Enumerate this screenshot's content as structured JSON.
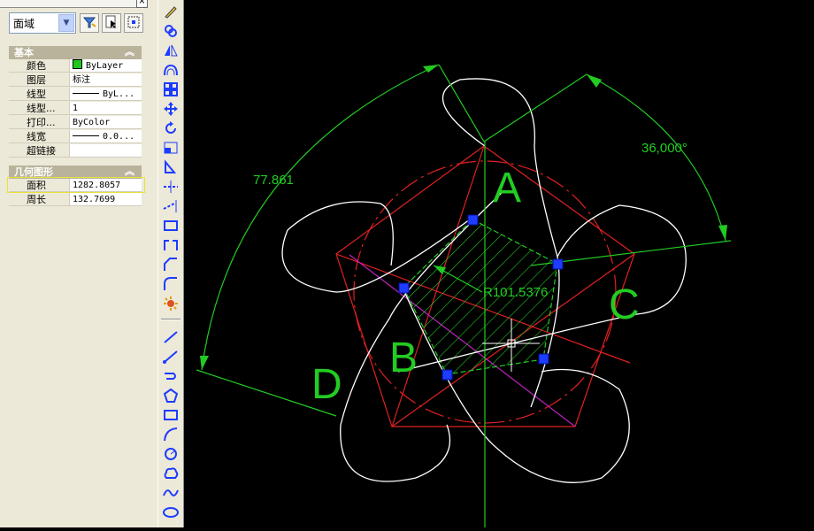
{
  "properties_palette": {
    "object_type": "面域",
    "sections": {
      "basic": {
        "title": "基本",
        "rows": [
          {
            "key": "颜色",
            "value": "ByLayer"
          },
          {
            "key": "图层",
            "value": "标注"
          },
          {
            "key": "线型",
            "value": "ByL..."
          },
          {
            "key": "线型...",
            "value": "1"
          },
          {
            "key": "打印...",
            "value": "ByColor"
          },
          {
            "key": "线宽",
            "value": "0.0..."
          },
          {
            "key": "超链接",
            "value": ""
          }
        ]
      },
      "geometry": {
        "title": "几何图形",
        "rows": [
          {
            "key": "面积",
            "value": "1282.8057"
          },
          {
            "key": "周长",
            "value": "132.7699"
          }
        ]
      }
    },
    "color_swatch": "#1ec81e",
    "highlight_color": "#e8e23a"
  },
  "drawing": {
    "dimension_angle": "36,000°",
    "dimension_arc": "77.861",
    "dimension_radius": "R101.5376",
    "labels": {
      "a": "A",
      "b": "B",
      "c": "C",
      "d": "D"
    },
    "colors": {
      "background": "#000000",
      "geometry": "#ffffff",
      "dimension": "#22cc22",
      "construction": "#e02020",
      "axis": "#c020c0",
      "grip": "#1e3cff"
    }
  },
  "toolbar_icons": [
    "pencil-icon",
    "copy-icon",
    "mirror-icon",
    "offset-icon",
    "array-icon",
    "move-icon",
    "rotate-icon",
    "scale-icon",
    "stretch-icon",
    "trim-icon",
    "extend-icon",
    "break-icon",
    "join-icon",
    "chamfer-icon",
    "fillet-icon",
    "explode-icon",
    "line-icon",
    "ray-icon",
    "polyline-icon",
    "polygon-icon",
    "rectangle-icon",
    "arc-icon",
    "circle-icon",
    "revcloud-icon",
    "spline-icon",
    "ellipse-icon"
  ]
}
